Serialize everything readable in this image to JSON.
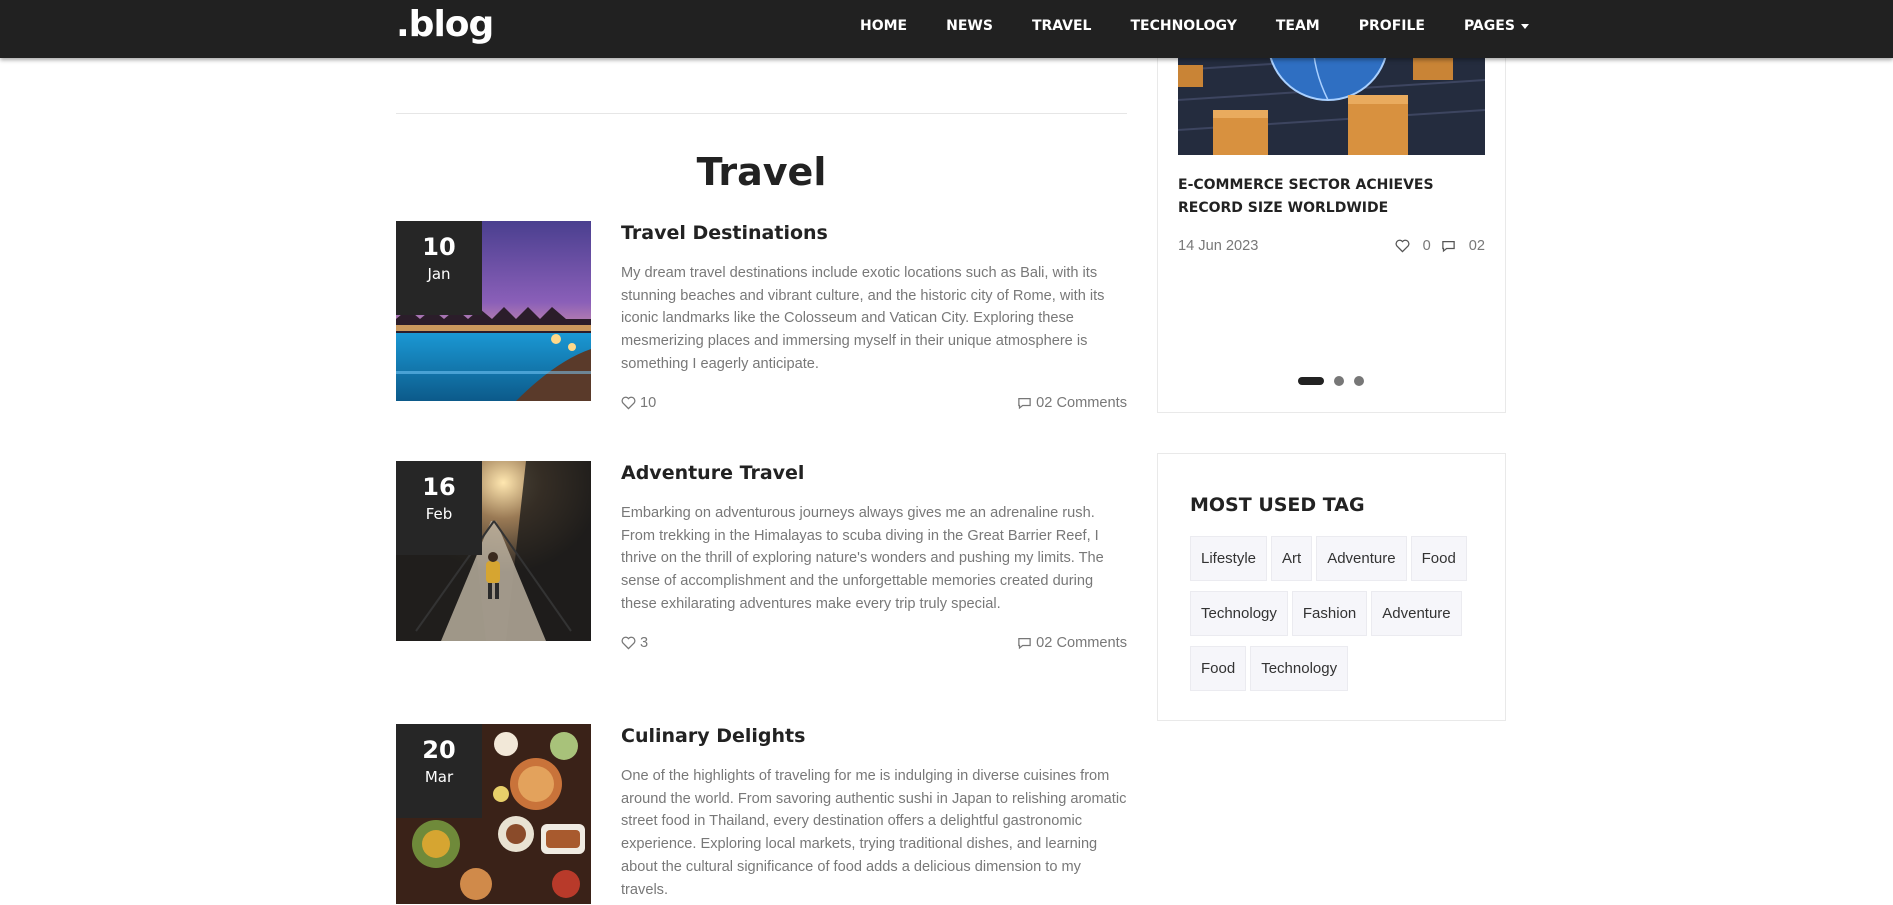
{
  "brand": ".blog",
  "nav": {
    "items": [
      "HOME",
      "NEWS",
      "TRAVEL",
      "TECHNOLOGY",
      "TEAM",
      "PROFILE",
      "PAGES"
    ]
  },
  "section": {
    "title": "Travel"
  },
  "posts": [
    {
      "day": "10",
      "month": "Jan",
      "title": "Travel Destinations",
      "text": "My dream travel destinations include exotic locations such as Bali, with its stunning beaches and vibrant culture, and the historic city of Rome, with its iconic landmarks like the Colosseum and Vatican City. Exploring these mesmerizing places and immersing myself in their unique atmosphere is something I eagerly anticipate.",
      "likes": "10",
      "comments": "02 Comments"
    },
    {
      "day": "16",
      "month": "Feb",
      "title": "Adventure Travel",
      "text": "Embarking on adventurous journeys always gives me an adrenaline rush. From trekking in the Himalayas to scuba diving in the Great Barrier Reef, I thrive on the thrill of exploring nature's wonders and pushing my limits. The sense of accomplishment and the unforgettable memories created during these exhilarating adventures make every trip truly special.",
      "likes": "3",
      "comments": "02 Comments"
    },
    {
      "day": "20",
      "month": "Mar",
      "title": "Culinary Delights",
      "text": "One of the highlights of traveling for me is indulging in diverse cuisines from around the world. From savoring authentic sushi in Japan to relishing aromatic street food in Thailand, every destination offers a delightful gastronomic experience. Exploring local markets, trying traditional dishes, and learning about the cultural significance of food adds a delicious dimension to my travels."
    }
  ],
  "carousel": {
    "title": "E-COMMERCE SECTOR ACHIEVES RECORD SIZE WORLDWIDE",
    "date": "14 Jun 2023",
    "likes": "0",
    "comments": "02",
    "active_index": 0,
    "slide_count": 3
  },
  "tags": {
    "title": "MOST USED TAG",
    "items": [
      "Lifestyle",
      "Art",
      "Adventure",
      "Food",
      "Technology",
      "Fashion",
      "Adventure",
      "Food",
      "Technology"
    ]
  },
  "icons": {
    "likes": "heart-icon",
    "comments": "comment-icon",
    "dropdown": "caret-down-icon"
  },
  "colors": {
    "navbar": "#212121",
    "date_badge": "#262626",
    "body_text": "#787878",
    "heading": "#222222",
    "tag_bg": "#f6f6fa"
  }
}
